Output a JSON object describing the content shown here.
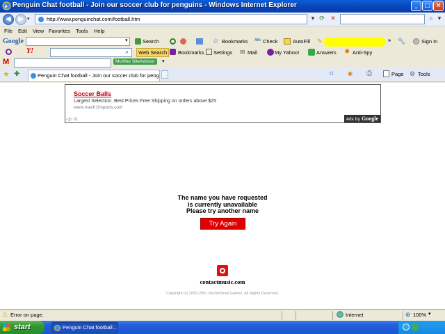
{
  "window": {
    "title": "Penguin Chat football - Join our soccer club for penguins - Windows Internet Explorer"
  },
  "address": {
    "url": "http://www.penguinchat.com/football.htm"
  },
  "menu": [
    "File",
    "Edit",
    "View",
    "Favorites",
    "Tools",
    "Help"
  ],
  "google_toolbar": {
    "logo": "Google",
    "search_label": "Search",
    "bookmarks_label": "Bookmarks",
    "check_label": "Check",
    "autofill_label": "AutoFill",
    "signin_label": "Sign In"
  },
  "yahoo_toolbar": {
    "web_search_label": "Web Search",
    "bookmarks_label": "Bookmarks",
    "settings_label": "Settings",
    "mail_label": "Mail",
    "myyahoo_label": "My Yahoo!",
    "answers_label": "Answers",
    "antispy_label": "Anti-Spy"
  },
  "mcafee_toolbar": {
    "siteadvisor_label": "McAfee SiteAdvisor"
  },
  "tabs": {
    "active_label": "Penguin Chat football - Join our soccer club for penguins",
    "page_label": "Page",
    "tools_label": "Tools"
  },
  "ad": {
    "title": "Soccer Balls",
    "description": "Largest Selection. Best Prices Free Shipping on orders above $25",
    "url": "www.mach10sports.com",
    "ads_by_prefix": "Ads by",
    "ads_by_brand": "Google"
  },
  "main": {
    "message": "The name you have requested\nis currently unavailable\nPlease try another name",
    "try_again_label": "Try Again",
    "brand": "contactmusic.com",
    "copyright": "Copyright (c) 2000-2001 RocketSnail Games. All Rights Reserved."
  },
  "status": {
    "text": "Error on page.",
    "zone": "Internet",
    "zoom": "100%"
  },
  "taskbar": {
    "start_label": "start",
    "task_label": "Penguin Chat football..."
  },
  "colors": {
    "accent_red": "#e00000",
    "ad_title": "#b8000a",
    "title_bar": "#0842b5",
    "taskbar": "#245edb"
  }
}
